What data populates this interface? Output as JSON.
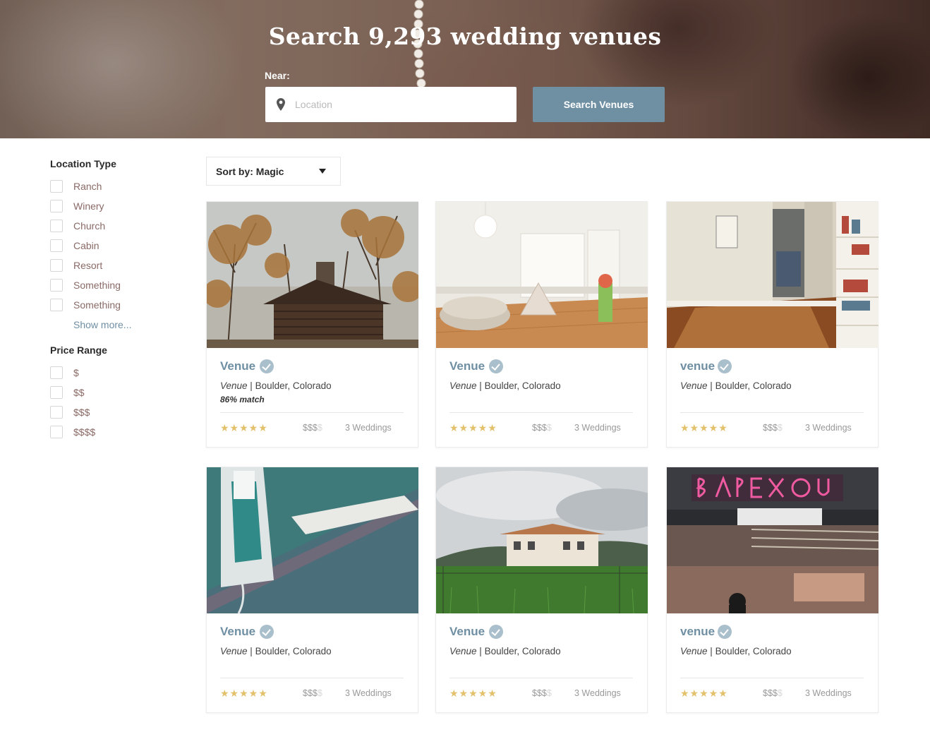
{
  "hero": {
    "title": "Search 9,293 wedding venues",
    "near_label": "Near:",
    "location_placeholder": "Location",
    "location_value": "",
    "search_button": "Search Venues"
  },
  "colors": {
    "accent": "#6f8fa3",
    "verified_badge": "#a9bfcc",
    "stars": "#e3c06a",
    "filter_label": "#8a6a66"
  },
  "sidebar": {
    "location_type": {
      "title": "Location Type",
      "items": [
        "Ranch",
        "Winery",
        "Church",
        "Cabin",
        "Resort",
        "Something",
        "Something"
      ],
      "show_more": "Show more..."
    },
    "price_range": {
      "title": "Price Range",
      "items": [
        "$",
        "$$",
        "$$$",
        "$$$$"
      ]
    }
  },
  "sort": {
    "label": "Sort by:",
    "value": "Magic"
  },
  "venues": [
    {
      "name": "Venue",
      "type": "Venue",
      "location": "Boulder, Colorado",
      "match": "86% match",
      "stars": "★★★★★",
      "price": "$$$",
      "price_dim": "$",
      "weddings": "3 Weddings",
      "photo": "cabin-in-autumn-trees",
      "verified_icon": "check-circle-icon"
    },
    {
      "name": "Venue",
      "type": "Venue",
      "location": "Boulder, Colorado",
      "match": "",
      "stars": "★★★★★",
      "price": "$$$",
      "price_dim": "$",
      "weddings": "3 Weddings",
      "photo": "bright-nursery-room",
      "verified_icon": "check-circle-icon"
    },
    {
      "name": "venue",
      "type": "Venue",
      "location": "Boulder, Colorado",
      "match": "",
      "stars": "★★★★★",
      "price": "$$$",
      "price_dim": "$",
      "weddings": "3 Weddings",
      "photo": "sunlit-hallway-bookshelf",
      "verified_icon": "check-circle-icon"
    },
    {
      "name": "Venue",
      "type": "Venue",
      "location": "Boulder, Colorado",
      "match": "",
      "stars": "★★★★★",
      "price": "$$$",
      "price_dim": "$",
      "weddings": "3 Weddings",
      "photo": "clothes-iron-on-board",
      "verified_icon": "check-circle-icon"
    },
    {
      "name": "Venue",
      "type": "Venue",
      "location": "Boulder, Colorado",
      "match": "",
      "stars": "★★★★★",
      "price": "$$$",
      "price_dim": "$",
      "weddings": "3 Weddings",
      "photo": "house-behind-fence",
      "verified_icon": "check-circle-icon"
    },
    {
      "name": "venue",
      "type": "Venue",
      "location": "Boulder, Colorado",
      "match": "",
      "stars": "★★★★★",
      "price": "$$$",
      "price_dim": "$",
      "weddings": "3 Weddings",
      "photo": "neon-storefront",
      "verified_icon": "check-circle-icon"
    }
  ]
}
